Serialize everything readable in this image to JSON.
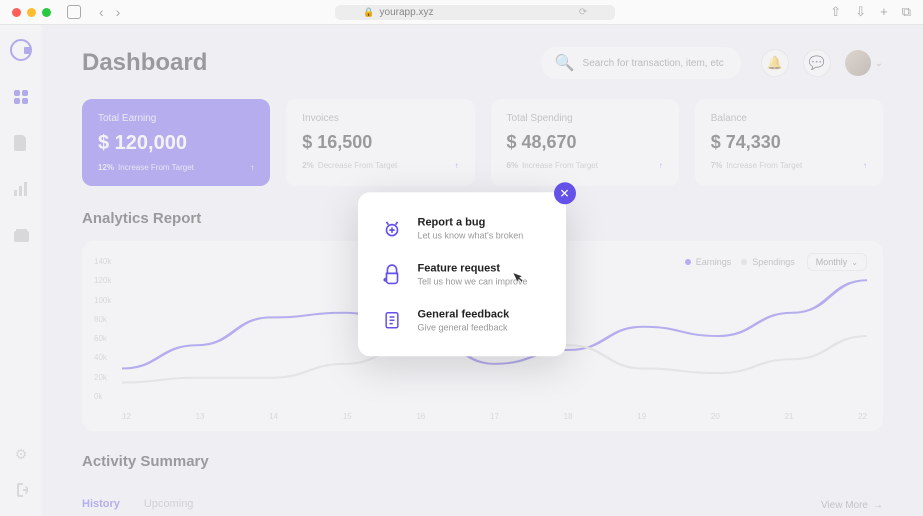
{
  "browser": {
    "url": "yourapp.xyz"
  },
  "header": {
    "title": "Dashboard",
    "search_placeholder": "Search for transaction, item, etc"
  },
  "cards": [
    {
      "label": "Total Earning",
      "value": "$ 120,000",
      "pct": "12%",
      "delta_text": "Increase From Target",
      "primary": true
    },
    {
      "label": "Invoices",
      "value": "$ 16,500",
      "pct": "2%",
      "delta_text": "Decrease From Target",
      "primary": false
    },
    {
      "label": "Total Spending",
      "value": "$ 48,670",
      "pct": "6%",
      "delta_text": "Increase From Target",
      "primary": false
    },
    {
      "label": "Balance",
      "value": "$ 74,330",
      "pct": "7%",
      "delta_text": "Increase From Target",
      "primary": false
    }
  ],
  "analytics": {
    "title": "Analytics Report",
    "legend": [
      {
        "label": "Earnings",
        "color": "#6452e8"
      },
      {
        "label": "Spendings",
        "color": "#d9d9d9"
      }
    ],
    "dropdown": "Monthly",
    "y_ticks": [
      "140k",
      "120k",
      "100k",
      "80k",
      "60k",
      "40k",
      "20k",
      "0k"
    ],
    "x_ticks": [
      "12",
      "13",
      "14",
      "15",
      "16",
      "17",
      "18",
      "19",
      "20",
      "21",
      "22"
    ]
  },
  "chart_data": {
    "type": "line",
    "x": [
      12,
      13,
      14,
      15,
      16,
      17,
      18,
      19,
      20,
      21,
      22
    ],
    "series": [
      {
        "name": "Earnings",
        "color": "#6452e8",
        "values": [
          35,
          60,
          90,
          95,
          75,
          40,
          55,
          80,
          70,
          95,
          130
        ]
      },
      {
        "name": "Spendings",
        "color": "#d9d9d9",
        "values": [
          20,
          25,
          25,
          40,
          65,
          75,
          60,
          35,
          30,
          45,
          70
        ]
      }
    ],
    "ylim": [
      0,
      140
    ],
    "ylabel": "k"
  },
  "activity": {
    "title": "Activity Summary",
    "tabs": [
      "History",
      "Upcoming"
    ],
    "active_tab": 0,
    "view_more": "View More"
  },
  "modal": {
    "items": [
      {
        "title": "Report a bug",
        "subtitle": "Let us know what's broken"
      },
      {
        "title": "Feature request",
        "subtitle": "Tell us how we can improve"
      },
      {
        "title": "General feedback",
        "subtitle": "Give general feedback"
      }
    ]
  }
}
